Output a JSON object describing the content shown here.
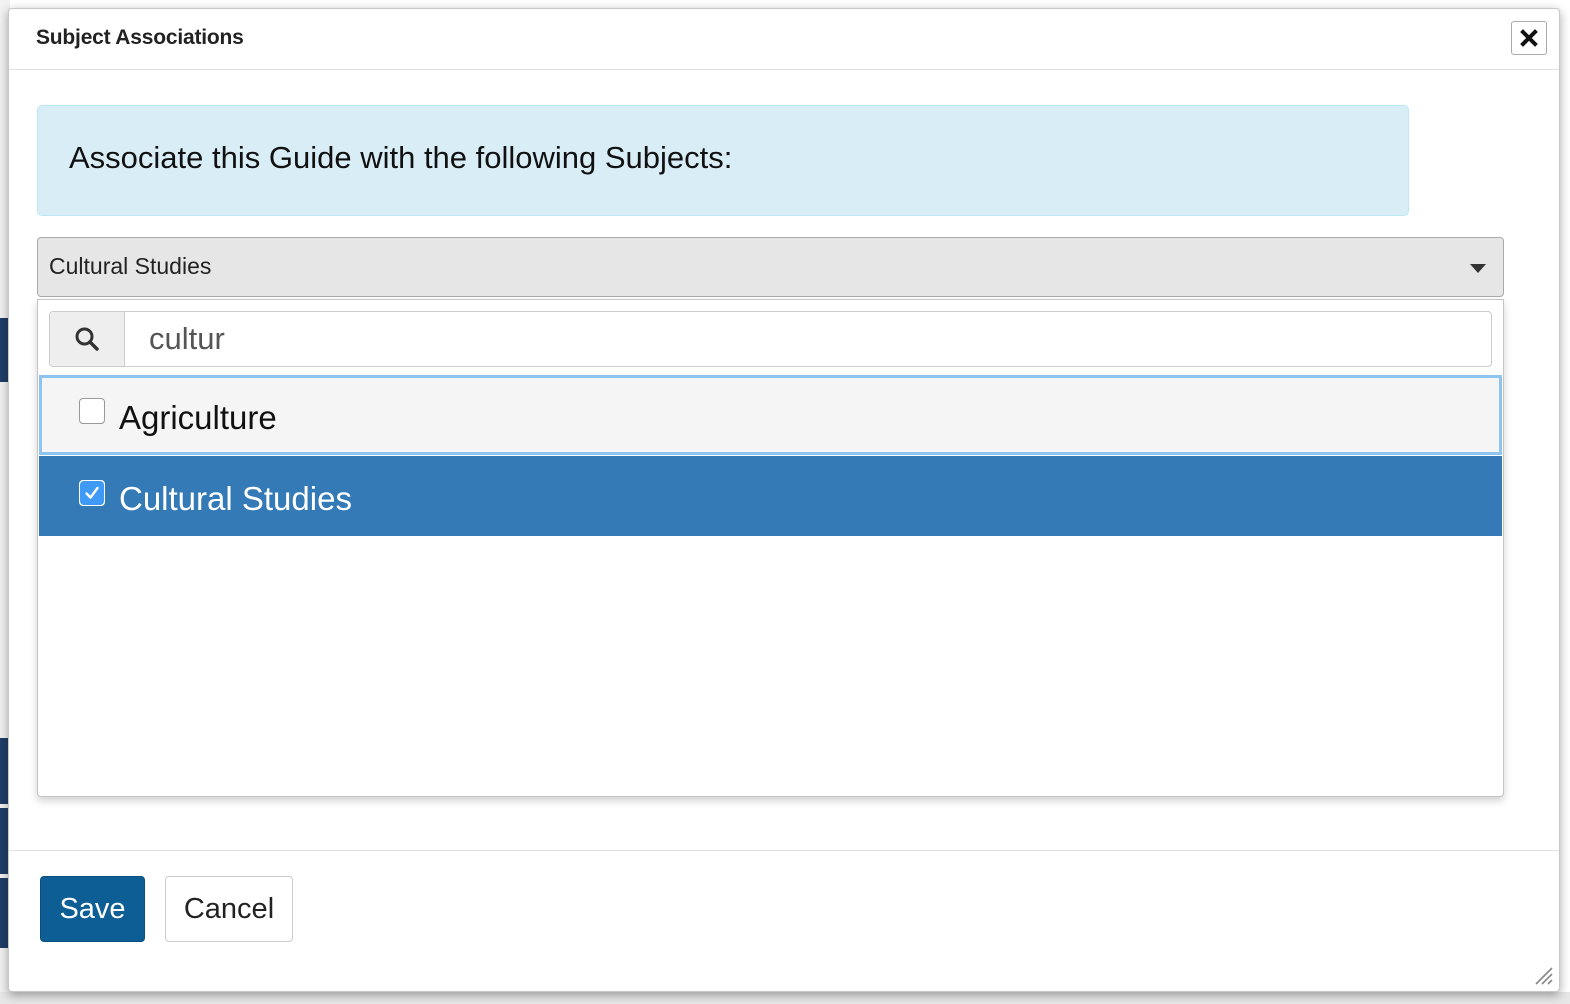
{
  "dialog": {
    "title": "Subject Associations",
    "close_icon": "close-icon"
  },
  "info": {
    "text": "Associate this Guide with the following Subjects:"
  },
  "subject_select": {
    "selected_value": "Cultural Studies",
    "arrow_icon": "caret-down-icon"
  },
  "dropdown": {
    "search": {
      "icon": "search-icon",
      "value": "cultur"
    },
    "options": [
      {
        "label": "Agriculture",
        "checked": false
      },
      {
        "label": "Cultural Studies",
        "checked": true
      }
    ]
  },
  "footer": {
    "save_label": "Save",
    "cancel_label": "Cancel"
  },
  "colors": {
    "primary": "#0d5e95",
    "selected_option": "#337ab7",
    "info_background": "#d9edf7",
    "focus_outline": "#8ec4f0"
  }
}
